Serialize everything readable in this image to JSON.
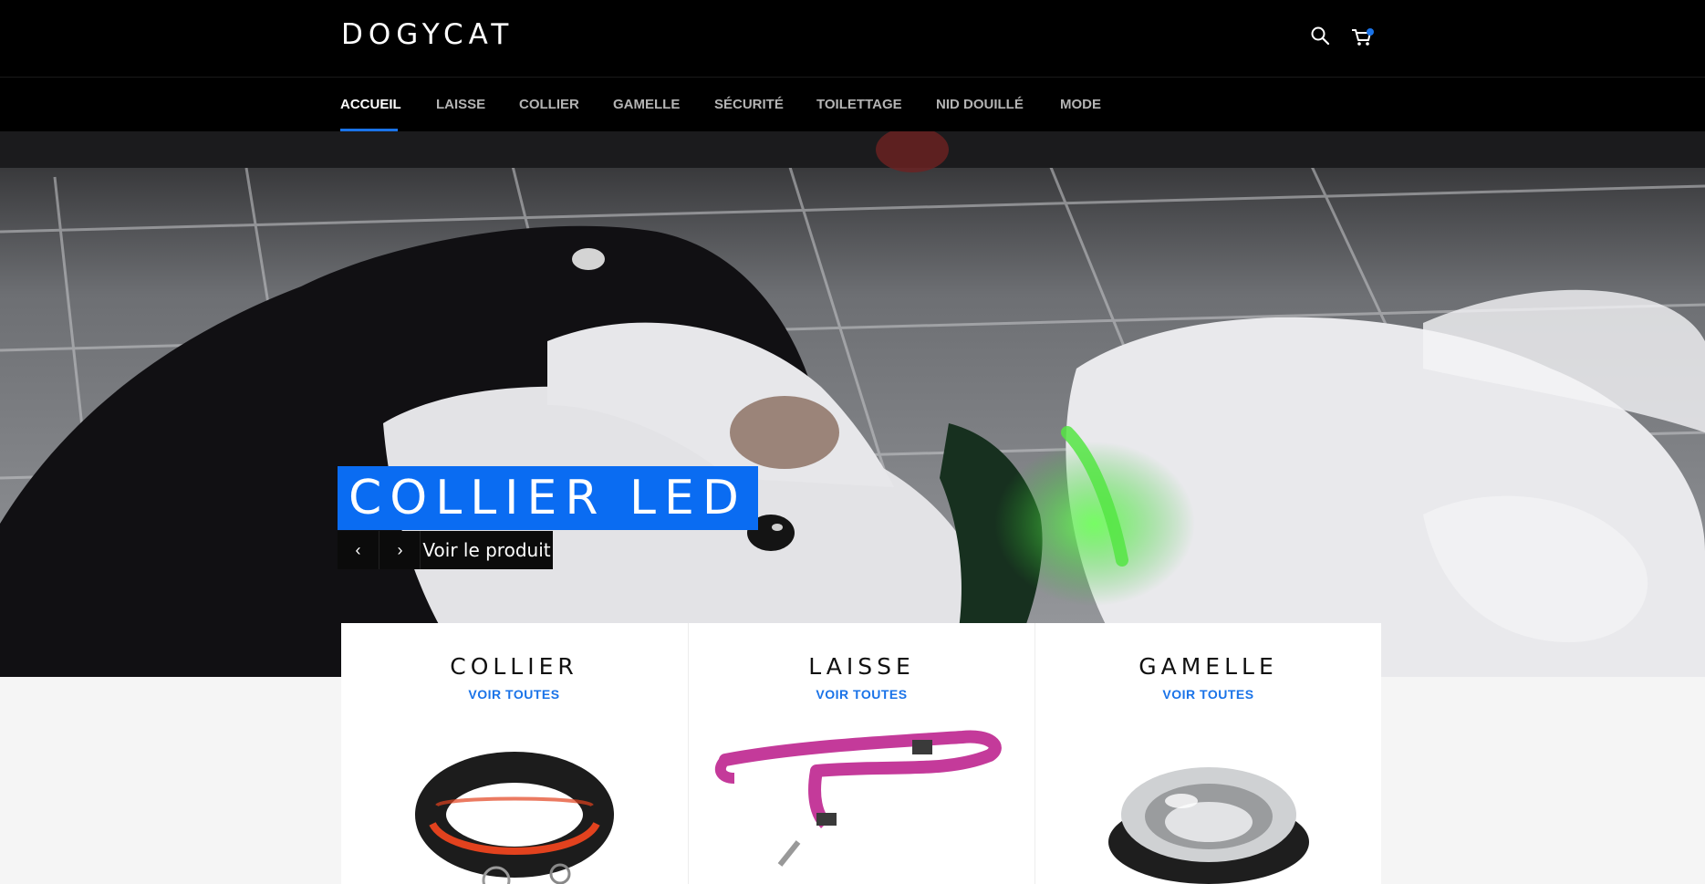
{
  "header": {
    "logo": "DOGYCAT",
    "icons": [
      "search-icon",
      "cart-icon"
    ]
  },
  "nav": {
    "items": [
      {
        "label": "ACCUEIL",
        "active": true
      },
      {
        "label": "LAISSE"
      },
      {
        "label": "COLLIER"
      },
      {
        "label": "GAMELLE"
      },
      {
        "label": "SÉCURITÉ"
      },
      {
        "label": "TOILETTAGE"
      },
      {
        "label": "NID DOUILLÉ"
      },
      {
        "label": "MODE"
      }
    ]
  },
  "hero": {
    "title": "COLLIER LED",
    "prev": "‹",
    "next": "›",
    "cta": "Voir le produit"
  },
  "collections": [
    {
      "title": "COLLIER",
      "link": "VOIR TOUTES"
    },
    {
      "title": "LAISSE",
      "link": "VOIR TOUTES"
    },
    {
      "title": "GAMELLE",
      "link": "VOIR TOUTES"
    }
  ],
  "colors": {
    "accent": "#1a73e8",
    "hero_title_bg": "#0a6cf2",
    "header_bg": "#000000"
  }
}
